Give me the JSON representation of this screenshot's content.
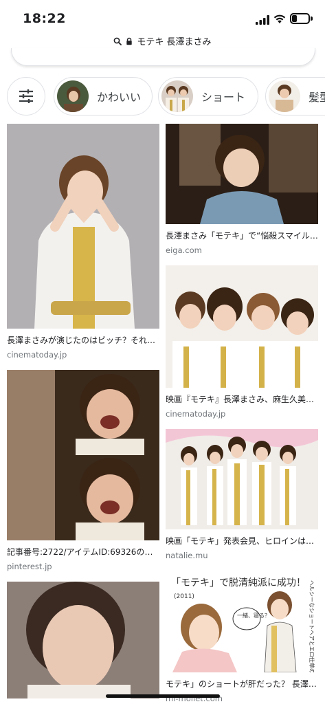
{
  "status_bar": {
    "time": "18:22"
  },
  "url_bar": {
    "url": "モテキ 長澤まさみ"
  },
  "chips": [
    {
      "label": "かわいい"
    },
    {
      "label": "ショート"
    },
    {
      "label": "髪型"
    }
  ],
  "results": [
    {
      "title": "長澤まさみが演じたのはビッチ？それ…",
      "domain": "cinematoday.jp"
    },
    {
      "title": "長澤まさみ「モテキ」で“悩殺スマイル…",
      "domain": "eiga.com"
    },
    {
      "title": "映画『モテキ』長澤まさみ、麻生久美…",
      "domain": "cinematoday.jp"
    },
    {
      "title": "記事番号:2722/アイテムID:69326の画…",
      "domain": "pinterest.jp"
    },
    {
      "title": "映画「モテキ」発表会見、ヒロインは…",
      "domain": "natalie.mu"
    },
    {
      "title": "モテキ」のショートが肝だった？ 長澤…",
      "domain": "mi-mollet.com"
    }
  ],
  "illustration_text": {
    "headline": "「モテキ」で脱清純派に成功！",
    "year": "(2011)",
    "bubble": "一緒、寝る？",
    "side": "ヘルシーなショートヘアとエロ仕草のギャップ"
  }
}
